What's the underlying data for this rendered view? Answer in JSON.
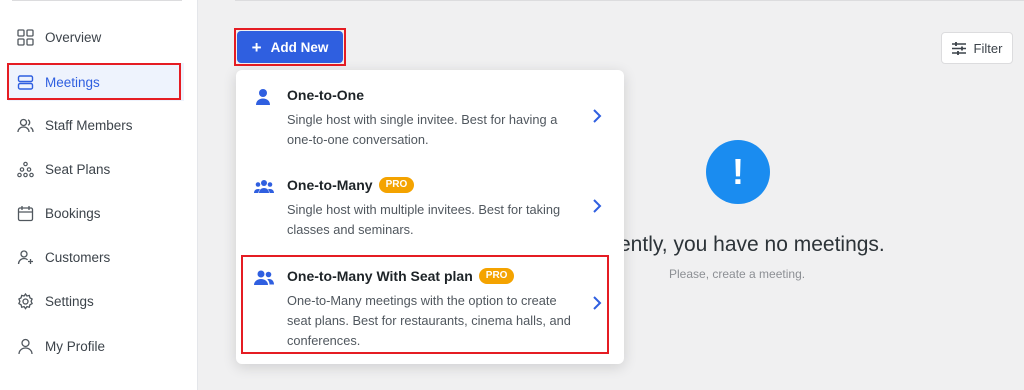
{
  "sidebar": {
    "items": [
      {
        "label": "Overview",
        "icon": "grid-icon"
      },
      {
        "label": "Meetings",
        "icon": "layers-icon",
        "active": true
      },
      {
        "label": "Staff Members",
        "icon": "users-icon"
      },
      {
        "label": "Seat Plans",
        "icon": "seats-icon"
      },
      {
        "label": "Bookings",
        "icon": "calendar-icon"
      },
      {
        "label": "Customers",
        "icon": "user-plus-icon"
      },
      {
        "label": "Settings",
        "icon": "gear-icon"
      },
      {
        "label": "My Profile",
        "icon": "user-icon"
      }
    ]
  },
  "toolbar": {
    "add_label": "Add New",
    "filter_label": "Filter"
  },
  "dropdown": {
    "items": [
      {
        "title": "One-to-One",
        "desc": "Single host with single invitee. Best for having a one-to-one conversation.",
        "pro": ""
      },
      {
        "title": "One-to-Many",
        "desc": "Single host with multiple invitees. Best for taking classes and seminars.",
        "pro": "PRO"
      },
      {
        "title": "One-to-Many With Seat plan",
        "desc": "One-to-Many meetings with the option to create seat plans. Best for restaurants, cinema halls, and conferences.",
        "pro": "PRO"
      }
    ]
  },
  "empty": {
    "icon_text": "!",
    "title": "ently, you have no meetings.",
    "subtitle": "Please, create a meeting."
  },
  "colors": {
    "accent": "#2f5fe0",
    "pro_badge": "#f4a300",
    "highlight": "#e51c23",
    "info": "#1a8cf0"
  }
}
